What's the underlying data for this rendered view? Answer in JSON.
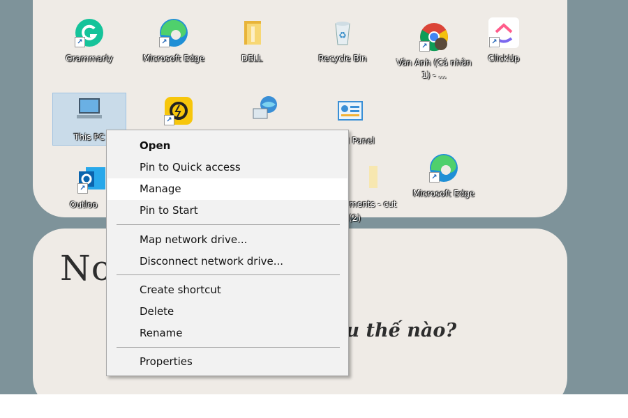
{
  "desktop": {
    "icons": [
      {
        "label": "Grammarly",
        "icon": "grammarly-icon"
      },
      {
        "label": "Microsoft Edge",
        "icon": "edge-icon"
      },
      {
        "label": "DELL",
        "icon": "folder-icon"
      },
      {
        "label": "Recycle Bin",
        "icon": "recycle-bin-icon"
      },
      {
        "label": "Vân Anh (Cá nhân 1) - ...",
        "icon": "chrome-profile-icon"
      },
      {
        "label": "ClickUp",
        "icon": "clickup-icon"
      },
      {
        "label": "This PC",
        "icon": "computer-icon"
      },
      {
        "label": "",
        "icon": "app-shortcut-icon"
      },
      {
        "label": "",
        "icon": "network-icon"
      },
      {
        "label": "l Panel",
        "icon": "control-panel-icon"
      },
      {
        "label": "Outloo",
        "icon": "outlook-icon"
      },
      {
        "label": "ments - cut (2)",
        "icon": "document-shortcut-icon"
      },
      {
        "label": "Microsoft Edge",
        "icon": "edge-icon"
      }
    ],
    "notes_title": "No",
    "notes_subtitle": "âu thế nào?"
  },
  "context_menu": {
    "items": [
      "Open",
      "Pin to Quick access",
      "Manage",
      "Pin to Start",
      "Map network drive...",
      "Disconnect network drive...",
      "Create shortcut",
      "Delete",
      "Rename",
      "Properties"
    ],
    "hovered": "Manage"
  },
  "colors": {
    "wallpaper": "#7e939a",
    "panel": "#efebe6",
    "menu_bg": "#f2f2f2",
    "menu_hover": "#ffffff",
    "selection": "#aacdeb"
  }
}
